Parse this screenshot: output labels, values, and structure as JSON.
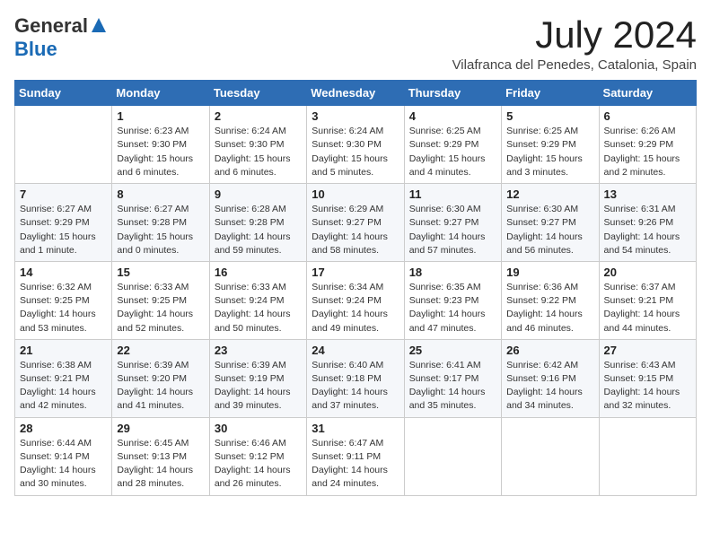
{
  "logo": {
    "general": "General",
    "blue": "Blue"
  },
  "title": "July 2024",
  "subtitle": "Vilafranca del Penedes, Catalonia, Spain",
  "weekdays": [
    "Sunday",
    "Monday",
    "Tuesday",
    "Wednesday",
    "Thursday",
    "Friday",
    "Saturday"
  ],
  "weeks": [
    [
      {
        "day": "",
        "info": ""
      },
      {
        "day": "1",
        "info": "Sunrise: 6:23 AM\nSunset: 9:30 PM\nDaylight: 15 hours\nand 6 minutes."
      },
      {
        "day": "2",
        "info": "Sunrise: 6:24 AM\nSunset: 9:30 PM\nDaylight: 15 hours\nand 6 minutes."
      },
      {
        "day": "3",
        "info": "Sunrise: 6:24 AM\nSunset: 9:30 PM\nDaylight: 15 hours\nand 5 minutes."
      },
      {
        "day": "4",
        "info": "Sunrise: 6:25 AM\nSunset: 9:29 PM\nDaylight: 15 hours\nand 4 minutes."
      },
      {
        "day": "5",
        "info": "Sunrise: 6:25 AM\nSunset: 9:29 PM\nDaylight: 15 hours\nand 3 minutes."
      },
      {
        "day": "6",
        "info": "Sunrise: 6:26 AM\nSunset: 9:29 PM\nDaylight: 15 hours\nand 2 minutes."
      }
    ],
    [
      {
        "day": "7",
        "info": "Sunrise: 6:27 AM\nSunset: 9:29 PM\nDaylight: 15 hours\nand 1 minute."
      },
      {
        "day": "8",
        "info": "Sunrise: 6:27 AM\nSunset: 9:28 PM\nDaylight: 15 hours\nand 0 minutes."
      },
      {
        "day": "9",
        "info": "Sunrise: 6:28 AM\nSunset: 9:28 PM\nDaylight: 14 hours\nand 59 minutes."
      },
      {
        "day": "10",
        "info": "Sunrise: 6:29 AM\nSunset: 9:27 PM\nDaylight: 14 hours\nand 58 minutes."
      },
      {
        "day": "11",
        "info": "Sunrise: 6:30 AM\nSunset: 9:27 PM\nDaylight: 14 hours\nand 57 minutes."
      },
      {
        "day": "12",
        "info": "Sunrise: 6:30 AM\nSunset: 9:27 PM\nDaylight: 14 hours\nand 56 minutes."
      },
      {
        "day": "13",
        "info": "Sunrise: 6:31 AM\nSunset: 9:26 PM\nDaylight: 14 hours\nand 54 minutes."
      }
    ],
    [
      {
        "day": "14",
        "info": "Sunrise: 6:32 AM\nSunset: 9:25 PM\nDaylight: 14 hours\nand 53 minutes."
      },
      {
        "day": "15",
        "info": "Sunrise: 6:33 AM\nSunset: 9:25 PM\nDaylight: 14 hours\nand 52 minutes."
      },
      {
        "day": "16",
        "info": "Sunrise: 6:33 AM\nSunset: 9:24 PM\nDaylight: 14 hours\nand 50 minutes."
      },
      {
        "day": "17",
        "info": "Sunrise: 6:34 AM\nSunset: 9:24 PM\nDaylight: 14 hours\nand 49 minutes."
      },
      {
        "day": "18",
        "info": "Sunrise: 6:35 AM\nSunset: 9:23 PM\nDaylight: 14 hours\nand 47 minutes."
      },
      {
        "day": "19",
        "info": "Sunrise: 6:36 AM\nSunset: 9:22 PM\nDaylight: 14 hours\nand 46 minutes."
      },
      {
        "day": "20",
        "info": "Sunrise: 6:37 AM\nSunset: 9:21 PM\nDaylight: 14 hours\nand 44 minutes."
      }
    ],
    [
      {
        "day": "21",
        "info": "Sunrise: 6:38 AM\nSunset: 9:21 PM\nDaylight: 14 hours\nand 42 minutes."
      },
      {
        "day": "22",
        "info": "Sunrise: 6:39 AM\nSunset: 9:20 PM\nDaylight: 14 hours\nand 41 minutes."
      },
      {
        "day": "23",
        "info": "Sunrise: 6:39 AM\nSunset: 9:19 PM\nDaylight: 14 hours\nand 39 minutes."
      },
      {
        "day": "24",
        "info": "Sunrise: 6:40 AM\nSunset: 9:18 PM\nDaylight: 14 hours\nand 37 minutes."
      },
      {
        "day": "25",
        "info": "Sunrise: 6:41 AM\nSunset: 9:17 PM\nDaylight: 14 hours\nand 35 minutes."
      },
      {
        "day": "26",
        "info": "Sunrise: 6:42 AM\nSunset: 9:16 PM\nDaylight: 14 hours\nand 34 minutes."
      },
      {
        "day": "27",
        "info": "Sunrise: 6:43 AM\nSunset: 9:15 PM\nDaylight: 14 hours\nand 32 minutes."
      }
    ],
    [
      {
        "day": "28",
        "info": "Sunrise: 6:44 AM\nSunset: 9:14 PM\nDaylight: 14 hours\nand 30 minutes."
      },
      {
        "day": "29",
        "info": "Sunrise: 6:45 AM\nSunset: 9:13 PM\nDaylight: 14 hours\nand 28 minutes."
      },
      {
        "day": "30",
        "info": "Sunrise: 6:46 AM\nSunset: 9:12 PM\nDaylight: 14 hours\nand 26 minutes."
      },
      {
        "day": "31",
        "info": "Sunrise: 6:47 AM\nSunset: 9:11 PM\nDaylight: 14 hours\nand 24 minutes."
      },
      {
        "day": "",
        "info": ""
      },
      {
        "day": "",
        "info": ""
      },
      {
        "day": "",
        "info": ""
      }
    ]
  ]
}
